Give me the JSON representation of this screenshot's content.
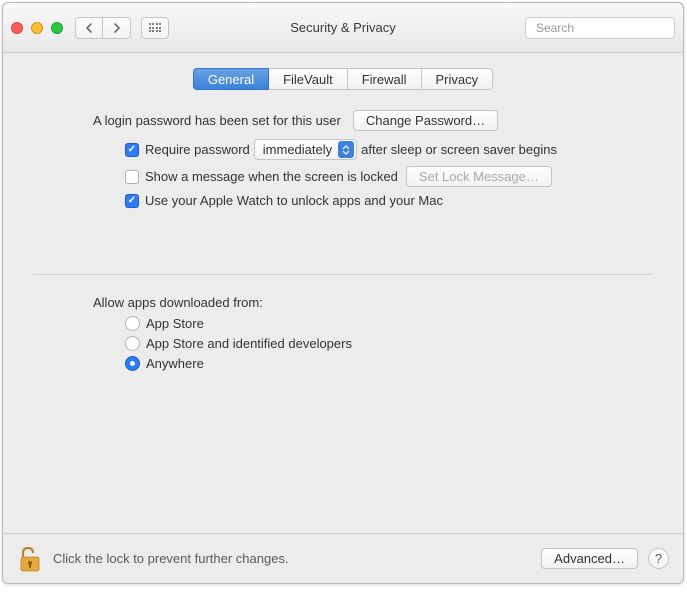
{
  "titlebar": {
    "title": "Security & Privacy",
    "search_placeholder": "Search"
  },
  "tabs": {
    "general": "General",
    "filevault": "FileVault",
    "firewall": "Firewall",
    "privacy": "Privacy",
    "active_index": 0
  },
  "login": {
    "description": "A login password has been set for this user",
    "change_button": "Change Password…",
    "require_password_label_prefix": "Require password",
    "require_password_select": "immediately",
    "require_password_label_suffix": "after sleep or screen saver begins",
    "require_password_checked": true,
    "show_message_label": "Show a message when the screen is locked",
    "show_message_checked": false,
    "set_lock_message_button": "Set Lock Message…",
    "apple_watch_label": "Use your Apple Watch to unlock apps and your Mac",
    "apple_watch_checked": true
  },
  "downloads": {
    "heading": "Allow apps downloaded from:",
    "options": [
      {
        "label": "App Store",
        "selected": false
      },
      {
        "label": "App Store and identified developers",
        "selected": false
      },
      {
        "label": "Anywhere",
        "selected": true
      }
    ]
  },
  "footer": {
    "lock_text": "Click the lock to prevent further changes.",
    "advanced_button": "Advanced…",
    "help_label": "?"
  }
}
